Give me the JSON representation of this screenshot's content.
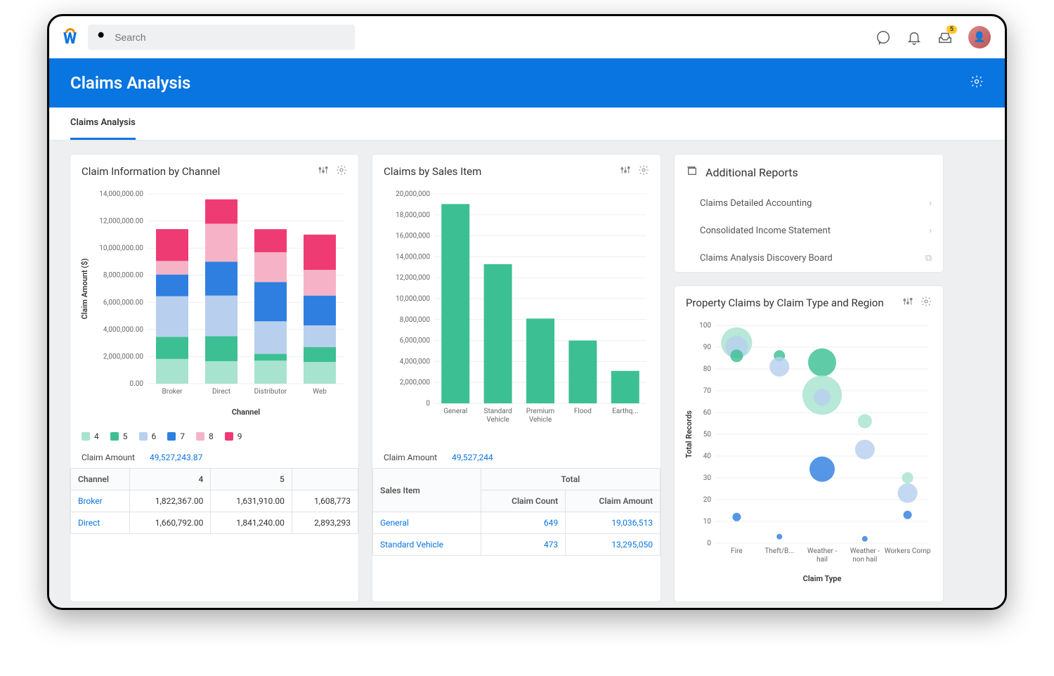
{
  "search": {
    "placeholder": "Search"
  },
  "topbar": {
    "inbox_badge": "5"
  },
  "page": {
    "title": "Claims Analysis"
  },
  "tabs": {
    "active": "Claims Analysis"
  },
  "card1": {
    "title": "Claim Information by Channel",
    "summary_label": "Claim Amount",
    "summary_value": "49,527,243.87",
    "legend_labels": [
      "4",
      "5",
      "6",
      "7",
      "8",
      "9"
    ],
    "table": {
      "headers": [
        "Channel",
        "4",
        "5",
        ""
      ],
      "rows": [
        [
          "Broker",
          "1,822,367.00",
          "1,631,910.00",
          "1,608,773"
        ],
        [
          "Direct",
          "1,660,792.00",
          "1,841,240.00",
          "2,893,293"
        ]
      ]
    }
  },
  "card2": {
    "title": "Claims by Sales Item",
    "summary_label": "Claim Amount",
    "summary_value": "49,527,244",
    "table": {
      "header_salesitem": "Sales Item",
      "header_total": "Total",
      "header_count": "Claim Count",
      "header_amount": "Claim Amount",
      "rows": [
        [
          "General",
          "649",
          "19,036,513"
        ],
        [
          "Standard Vehicle",
          "473",
          "13,295,050"
        ]
      ]
    }
  },
  "card3": {
    "title": "Additional Reports",
    "items": [
      "Claims Detailed Accounting",
      "Consolidated Income Statement",
      "Claims Analysis Discovery Board"
    ]
  },
  "card4": {
    "title": "Property Claims by Claim Type and Region"
  },
  "chart_data": [
    {
      "id": "claim_info_by_channel",
      "type": "bar",
      "stacked": true,
      "title": "Claim Information by Channel",
      "xlabel": "Channel",
      "ylabel": "Claim Amount ($)",
      "categories": [
        "Broker",
        "Direct",
        "Distributor",
        "Web"
      ],
      "ylim": [
        0,
        14000000
      ],
      "yticks": [
        0,
        2000000,
        4000000,
        6000000,
        8000000,
        10000000,
        12000000,
        14000000
      ],
      "ytick_labels": [
        "0.00",
        "2,000,000.00",
        "4,000,000.00",
        "6,000,000.00",
        "8,000,000.00",
        "10,000,000.00",
        "12,000,000.00",
        "14,000,000.00"
      ],
      "series": [
        {
          "name": "4",
          "color": "#a7e3cf",
          "values": [
            1822367,
            1660792,
            1700000,
            1600000
          ]
        },
        {
          "name": "5",
          "color": "#3dbf94",
          "values": [
            1631910,
            1841240,
            500000,
            1100000
          ]
        },
        {
          "name": "6",
          "color": "#b8d0ee",
          "values": [
            3000000,
            3000000,
            2400000,
            1600000
          ]
        },
        {
          "name": "7",
          "color": "#2f7fe0",
          "values": [
            1600000,
            2500000,
            2900000,
            2200000
          ]
        },
        {
          "name": "8",
          "color": "#f6b3c8",
          "values": [
            1000000,
            2800000,
            2200000,
            1900000
          ]
        },
        {
          "name": "9",
          "color": "#ef3b74",
          "values": [
            2350000,
            1800000,
            1700000,
            2600000
          ]
        }
      ]
    },
    {
      "id": "claims_by_sales_item",
      "type": "bar",
      "title": "Claims by Sales Item",
      "xlabel": "",
      "ylabel": "",
      "categories": [
        "General",
        "Standard Vehicle",
        "Premium Vehicle",
        "Flood",
        "Earthq..."
      ],
      "ylim": [
        0,
        20000000
      ],
      "yticks": [
        0,
        2000000,
        4000000,
        6000000,
        8000000,
        10000000,
        12000000,
        14000000,
        16000000,
        18000000,
        20000000
      ],
      "ytick_labels": [
        "0",
        "2,000,000",
        "4,000,000",
        "6,000,000",
        "8,000,000",
        "10,000,000",
        "12,000,000",
        "14,000,000",
        "16,000,000",
        "18,000,000",
        "20,000,000"
      ],
      "series": [
        {
          "name": "Claim Amount",
          "color": "#3dbf94",
          "values": [
            19036513,
            13295050,
            8100000,
            6000000,
            3100000
          ]
        }
      ]
    },
    {
      "id": "property_claims_bubble",
      "type": "scatter",
      "title": "Property Claims by Claim Type and Region",
      "xlabel": "Claim Type",
      "ylabel": "Total Records",
      "x_categories": [
        "Fire",
        "Theft/B...",
        "Weather - hail",
        "Weather - non hail",
        "Workers Comp"
      ],
      "ylim": [
        0,
        100
      ],
      "yticks": [
        0,
        10,
        20,
        30,
        40,
        50,
        60,
        70,
        80,
        90,
        100
      ],
      "points": [
        {
          "x": 0,
          "y": 92,
          "r": 22,
          "color": "#a7e3cf"
        },
        {
          "x": 0,
          "y": 90,
          "r": 16,
          "color": "#b8d0ee"
        },
        {
          "x": 0,
          "y": 86,
          "r": 9,
          "color": "#3dbf94"
        },
        {
          "x": 0,
          "y": 12,
          "r": 6,
          "color": "#2f7fe0"
        },
        {
          "x": 1,
          "y": 86,
          "r": 8,
          "color": "#3dbf94"
        },
        {
          "x": 1,
          "y": 81,
          "r": 14,
          "color": "#b8d0ee"
        },
        {
          "x": 1,
          "y": 3,
          "r": 4,
          "color": "#2f7fe0"
        },
        {
          "x": 2,
          "y": 83,
          "r": 20,
          "color": "#3dbf94"
        },
        {
          "x": 2,
          "y": 68,
          "r": 28,
          "color": "#a7e3cf"
        },
        {
          "x": 2,
          "y": 67,
          "r": 12,
          "color": "#b8d0ee"
        },
        {
          "x": 2,
          "y": 34,
          "r": 18,
          "color": "#2f7fe0"
        },
        {
          "x": 3,
          "y": 56,
          "r": 10,
          "color": "#a7e3cf"
        },
        {
          "x": 3,
          "y": 43,
          "r": 14,
          "color": "#b8d0ee"
        },
        {
          "x": 3,
          "y": 2,
          "r": 4,
          "color": "#2f7fe0"
        },
        {
          "x": 4,
          "y": 30,
          "r": 8,
          "color": "#a7e3cf"
        },
        {
          "x": 4,
          "y": 23,
          "r": 14,
          "color": "#b8d0ee"
        },
        {
          "x": 4,
          "y": 13,
          "r": 6,
          "color": "#2f7fe0"
        }
      ]
    }
  ],
  "colors": {
    "series4": "#a7e3cf",
    "series5": "#3dbf94",
    "series6": "#b8d0ee",
    "series7": "#2f7fe0",
    "series8": "#f6b3c8",
    "series9": "#ef3b74"
  }
}
